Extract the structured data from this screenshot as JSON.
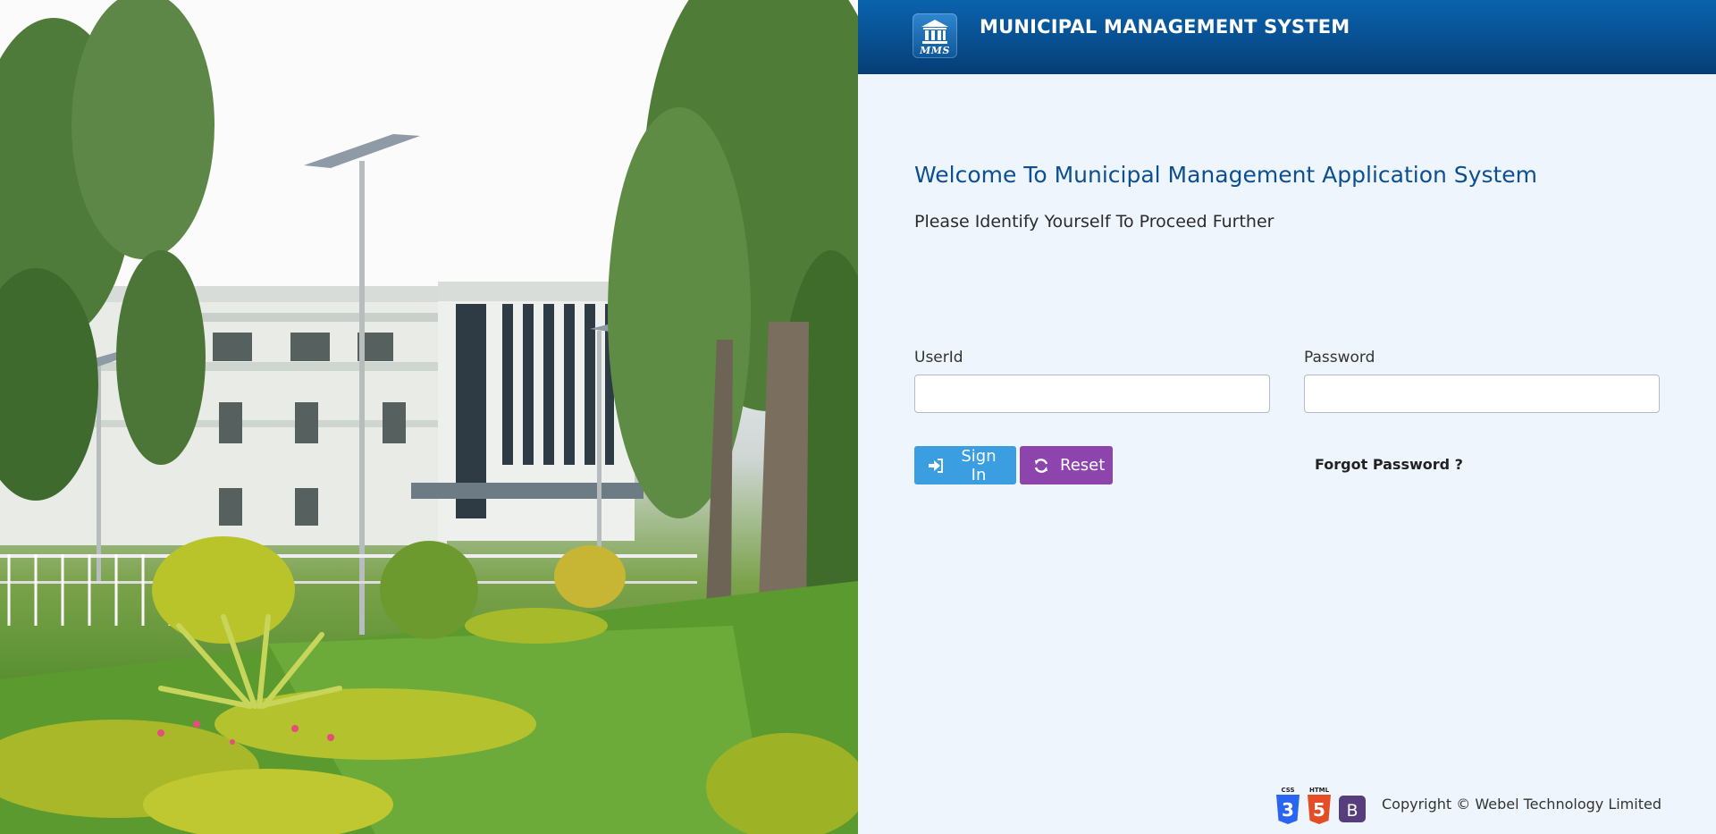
{
  "header": {
    "logo_text": "MMS",
    "title": "MUNICIPAL MANAGEMENT SYSTEM"
  },
  "main": {
    "welcome": "Welcome To Municipal Management Application System",
    "subtitle": "Please Identify Yourself To Proceed Further"
  },
  "form": {
    "userid_label": "UserId",
    "userid_value": "",
    "password_label": "Password",
    "password_value": "",
    "signin_label": "Sign In",
    "reset_label": "Reset",
    "forgot_label": "Forgot Password ?"
  },
  "footer": {
    "badges": [
      {
        "label": "CSS",
        "letter": "3",
        "color": "#2965f1"
      },
      {
        "label": "HTML",
        "letter": "5",
        "color": "#e44d26"
      },
      {
        "label": "",
        "letter": "B",
        "color": "#563d7c"
      }
    ],
    "copyright": "Copyright © Webel Technology Limited"
  },
  "colors": {
    "header": "#084f90",
    "welcome": "#0d4f91",
    "signin": "#3b9ee0",
    "reset": "#8e44ad",
    "background": "#eef5fd"
  },
  "icons": {
    "logo": "building-columns-icon",
    "signin": "sign-in-arrow-icon",
    "reset": "refresh-icon"
  }
}
